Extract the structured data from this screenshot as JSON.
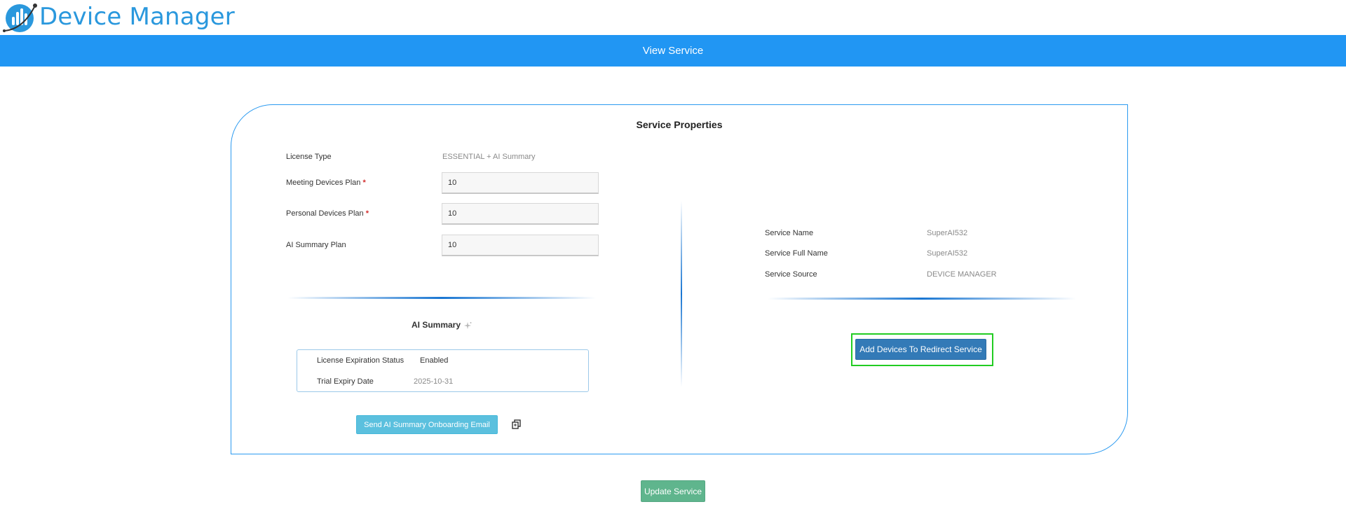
{
  "header": {
    "app_title": "Device Manager",
    "logo_icon": "device-manager-logo-icon"
  },
  "title_bar": {
    "text": "View Service",
    "color": "#2196f3"
  },
  "service_properties": {
    "title": "Service Properties",
    "license_type": {
      "label": "License Type",
      "value": "ESSENTIAL + AI Summary"
    },
    "meeting_devices_plan": {
      "label": "Meeting Devices Plan",
      "required_mark": "*",
      "value": "10"
    },
    "personal_devices_plan": {
      "label": "Personal Devices Plan",
      "required_mark": "*",
      "value": "10"
    },
    "ai_summary_plan": {
      "label": "AI Summary Plan",
      "value": "10"
    },
    "service_name": {
      "label": "Service Name",
      "value": "SuperAI532"
    },
    "service_full_name": {
      "label": "Service Full Name",
      "value": "SuperAI532"
    },
    "service_source": {
      "label": "Service Source",
      "value": "DEVICE MANAGER"
    }
  },
  "ai_summary": {
    "title": "AI Summary",
    "icon": "sparkle-icon",
    "license_expiration_status": {
      "label": "License Expiration Status",
      "value": "Enabled"
    },
    "trial_expiry_date": {
      "label": "Trial Expiry Date",
      "value": "2025-10-31"
    }
  },
  "buttons": {
    "send_onboarding_email": "Send AI Summary Onboarding Email",
    "copy_icon": "copy-icon",
    "add_devices_redirect": "Add Devices To Redirect Service",
    "update_service": "Update Service"
  },
  "colors": {
    "accent": "#2196f3",
    "brand_text": "#2a98dd",
    "primary_button": "#337ab7",
    "info_button": "#5bc0de",
    "success_button": "#5fb58d",
    "required": "#d32f2f",
    "highlight": "#22cc22"
  }
}
